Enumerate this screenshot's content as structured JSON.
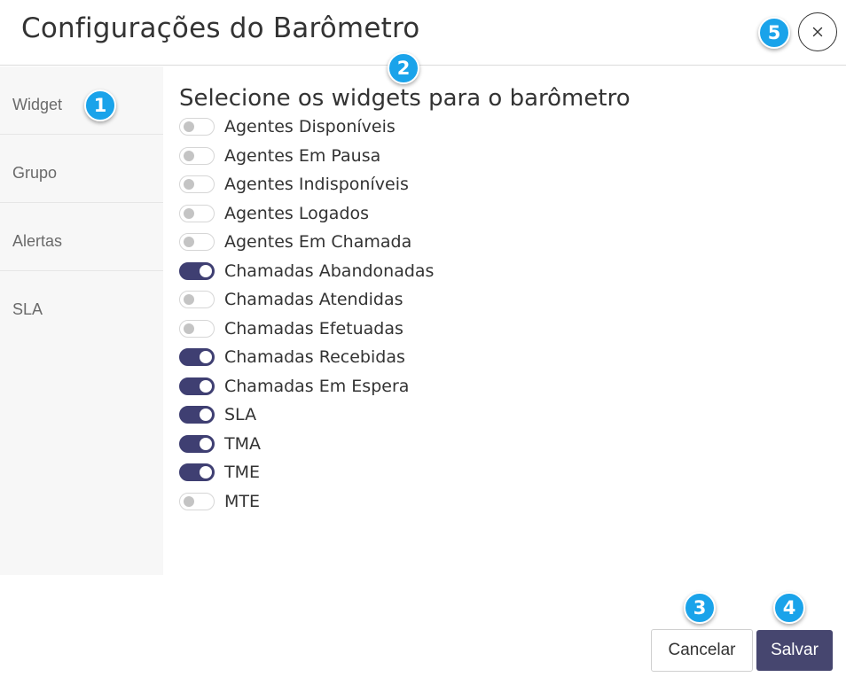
{
  "dialog": {
    "title": "Configurações do Barômetro",
    "close_icon": "close-icon"
  },
  "sidebar": {
    "items": [
      {
        "label": "Widget"
      },
      {
        "label": "Grupo"
      },
      {
        "label": "Alertas"
      },
      {
        "label": "SLA"
      }
    ]
  },
  "main": {
    "section_title": "Selecione os widgets para o barômetro",
    "widgets": [
      {
        "label": "Agentes Disponíveis",
        "enabled": false
      },
      {
        "label": "Agentes Em Pausa",
        "enabled": false
      },
      {
        "label": "Agentes Indisponíveis",
        "enabled": false
      },
      {
        "label": "Agentes Logados",
        "enabled": false
      },
      {
        "label": "Agentes Em Chamada",
        "enabled": false
      },
      {
        "label": "Chamadas Abandonadas",
        "enabled": true
      },
      {
        "label": "Chamadas Atendidas",
        "enabled": false
      },
      {
        "label": "Chamadas Efetuadas",
        "enabled": false
      },
      {
        "label": "Chamadas Recebidas",
        "enabled": true
      },
      {
        "label": "Chamadas Em Espera",
        "enabled": true
      },
      {
        "label": "SLA",
        "enabled": true
      },
      {
        "label": "TMA",
        "enabled": true
      },
      {
        "label": "TME",
        "enabled": true
      },
      {
        "label": "MTE",
        "enabled": false
      }
    ]
  },
  "footer": {
    "cancel_label": "Cancelar",
    "save_label": "Salvar"
  },
  "annotations": [
    "1",
    "2",
    "3",
    "4",
    "5"
  ],
  "colors": {
    "accent": "#46466f",
    "toggle_on": "#3f3f72",
    "badge": "#1aa3ea",
    "sidebar_bg": "#f7f7f7"
  }
}
